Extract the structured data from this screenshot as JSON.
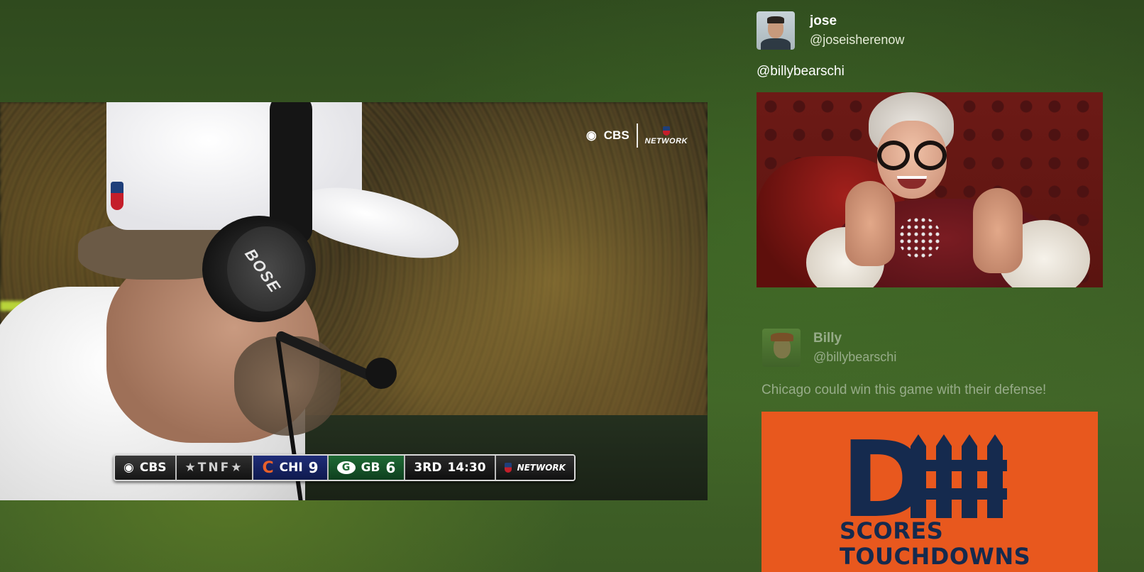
{
  "video": {
    "network_logo": "CBS",
    "network_sub": "NETWORK",
    "headset_brand": "BOSE",
    "scorebug": {
      "broadcaster": "CBS",
      "program": "★TNF★",
      "team_away": "CHI",
      "score_away": "9",
      "team_home": "GB",
      "score_home": "6",
      "quarter": "3RD",
      "clock": "14:30",
      "league_network": "NETWORK"
    }
  },
  "feed": {
    "post1": {
      "name": "jose",
      "handle": "@joseisherenow",
      "text": "@billybearschi"
    },
    "post2": {
      "name": "Billy",
      "handle": "@billybearschi",
      "text": "Chicago could win this game with their defense!",
      "image_line1": "SCORES",
      "image_line2": "TOUCHDOWNS"
    }
  },
  "colors": {
    "background": "#3a5a24",
    "card_orange": "#e8581e",
    "card_navy": "#152a4e"
  }
}
